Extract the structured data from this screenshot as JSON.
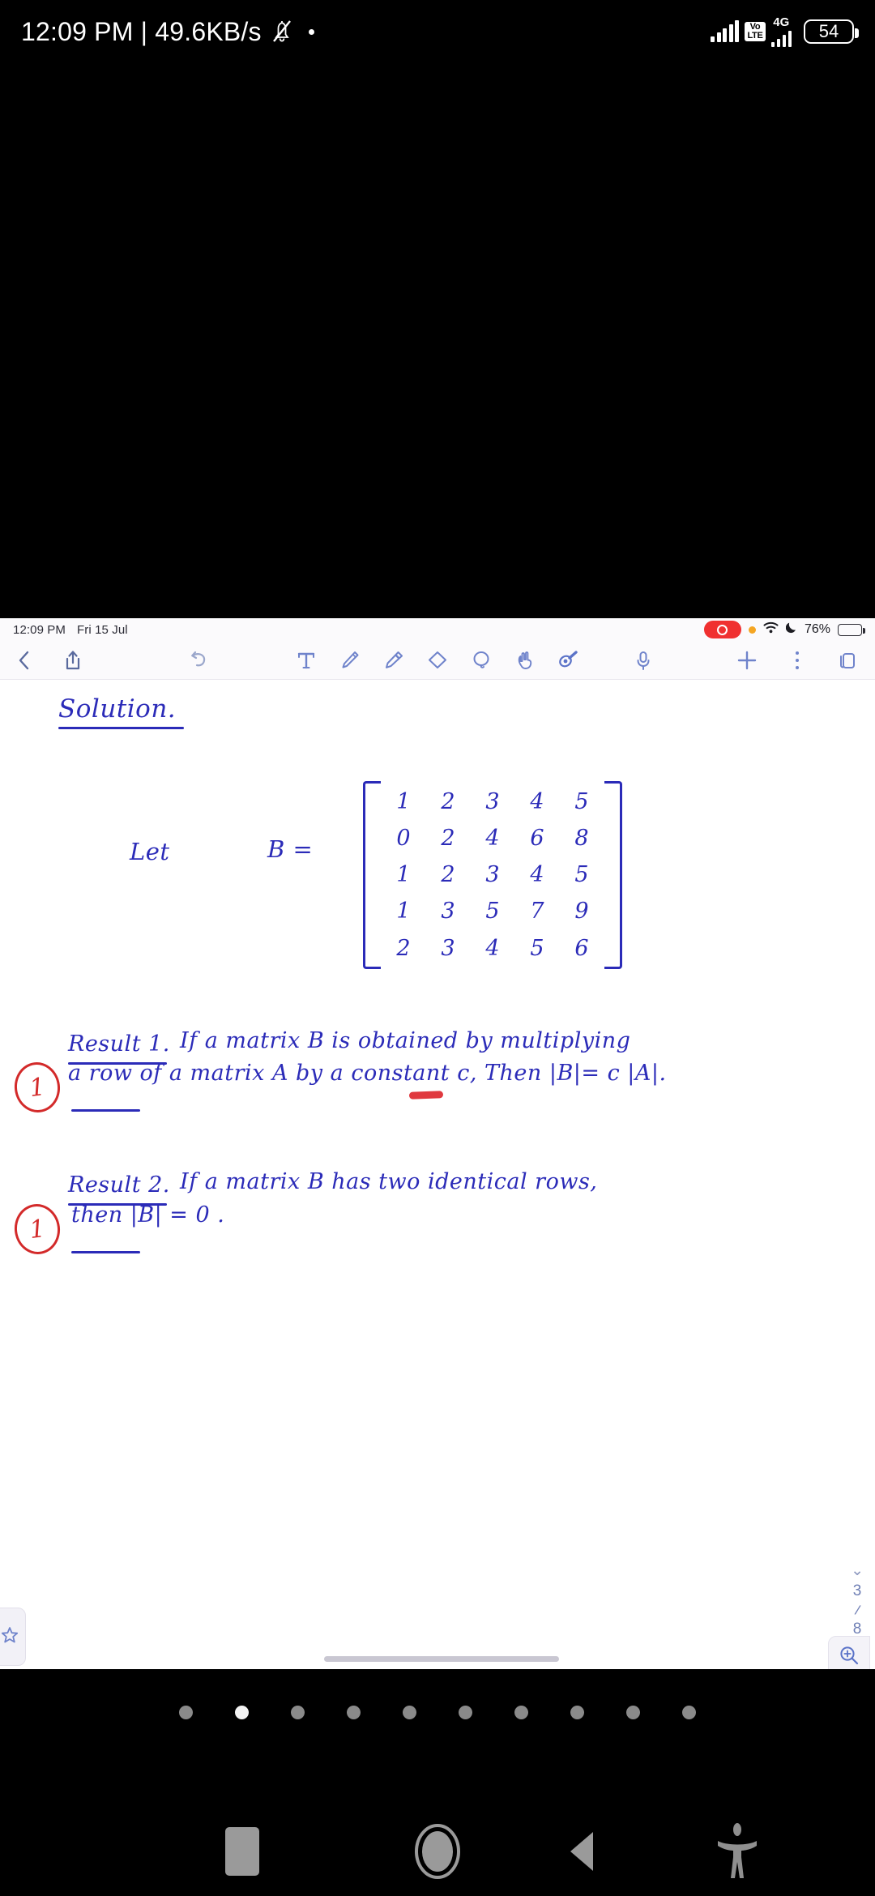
{
  "system_status_bar": {
    "clock": "12:09 PM | 49.6KB/s",
    "mute_icon": "bell-slash-icon",
    "dot_icon": "notification-dot-icon",
    "signal_icon_1": "signal-bars-icon",
    "volte_top": "Vo",
    "volte_bottom": "LTE",
    "network_type": "4G",
    "signal_icon_2": "signal-bars-icon-sim2",
    "battery_percent": "54"
  },
  "inner_device": {
    "status_bar": {
      "time": "12:09 PM",
      "date": "Fri 15 Jul",
      "recording_icon": "screen-recording-pill",
      "orange_dot": "microphone-in-use-dot",
      "wifi_icon": "wifi-icon",
      "dnd_icon": "do-not-disturb-moon-icon",
      "battery_percent": "76%",
      "battery_icon": "battery-icon"
    },
    "toolbar": {
      "back_icon": "back-chevron-icon",
      "share_icon": "share-icon",
      "undo_icon": "undo-icon",
      "tools": [
        {
          "name": "text-tool",
          "icon": "text-T-icon"
        },
        {
          "name": "pen-tool",
          "icon": "pen-icon"
        },
        {
          "name": "highlighter-tool",
          "icon": "highlighter-icon"
        },
        {
          "name": "eraser-tool",
          "icon": "eraser-icon"
        },
        {
          "name": "lasso-tool",
          "icon": "lasso-icon"
        },
        {
          "name": "hand-tool",
          "icon": "hand-icon"
        },
        {
          "name": "laser-pointer-tool",
          "icon": "laser-pointer-icon"
        }
      ],
      "mic_icon": "microphone-icon",
      "add_icon": "plus-icon",
      "more_icon": "more-vertical-icon",
      "pages_icon": "pages-icon"
    },
    "note": {
      "heading": "Solution.",
      "let_label": "Let",
      "matrix_label": "B =",
      "matrix": [
        [
          "1",
          "2",
          "3",
          "4",
          "5"
        ],
        [
          "0",
          "2",
          "4",
          "6",
          "8"
        ],
        [
          "1",
          "2",
          "3",
          "4",
          "5"
        ],
        [
          "1",
          "3",
          "5",
          "7",
          "9"
        ],
        [
          "2",
          "3",
          "4",
          "5",
          "6"
        ]
      ],
      "result1": {
        "title": "Result 1.",
        "line1": "If a matrix B is obtained by multiplying",
        "line2": "a row of a matrix A by a constant c, Then |B|= c |A|.",
        "margin_mark": "1"
      },
      "result2": {
        "title": "Result 2.",
        "line1": "If a matrix B has two identical rows,",
        "line2": "then  |B| = 0 .",
        "margin_mark": "1"
      }
    },
    "page_nav": {
      "up_icon": "chevron-up-icon",
      "current_page": "3",
      "separator": "/",
      "total_pages": "8",
      "down_icon": "chevron-down-icon",
      "zoom_icon": "zoom-in-icon"
    },
    "bookmark_tab_icon": "star-icon",
    "scrollbar": "horizontal-scroll-handle"
  },
  "gallery": {
    "dots_total": 10,
    "active_dot_index": 1
  },
  "nav_bar": {
    "recents_icon": "recents-square-icon",
    "home_icon": "home-circle-icon",
    "back_icon": "back-triangle-icon",
    "accessibility_icon": "accessibility-icon"
  },
  "colors": {
    "ink_blue": "#2b2bb8",
    "ink_red": "#d32a2a",
    "highlight_red": "#e0393f",
    "tool_blue": "#7b8fd4",
    "page_white": "#ffffff"
  }
}
